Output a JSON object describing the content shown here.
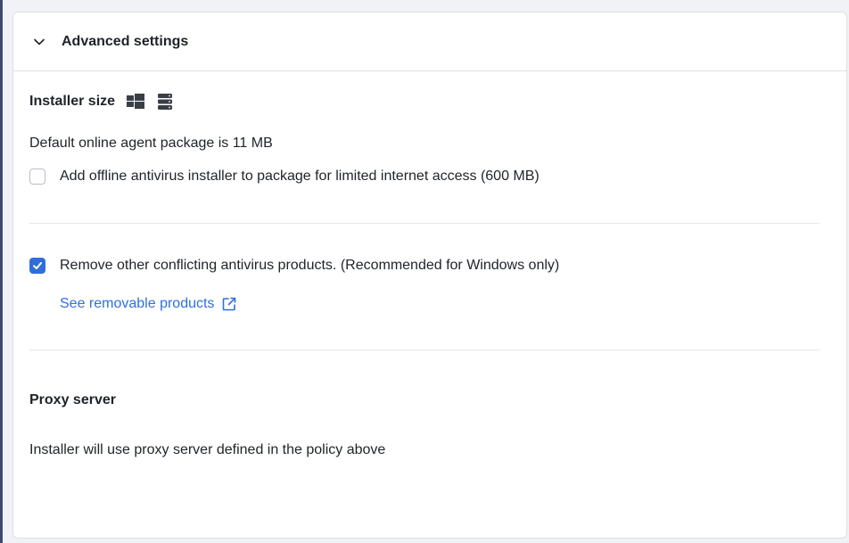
{
  "panel": {
    "header_title": "Advanced settings",
    "chevron_icon": "chevron-down-icon"
  },
  "installer": {
    "title": "Installer size",
    "icons": [
      "windows-icon",
      "server-icon"
    ],
    "default_text": "Default online agent package is 11 MB",
    "offline_checkbox": {
      "label": "Add offline antivirus installer to package for limited internet access (600 MB)",
      "checked": false
    }
  },
  "conflicts": {
    "remove_checkbox": {
      "label": "Remove other conflicting antivirus products. (Recommended for Windows only)",
      "checked": true
    },
    "link_label": "See removable products",
    "link_icon": "external-link-icon"
  },
  "proxy": {
    "title": "Proxy server",
    "text": "Installer will use proxy server defined in the policy above"
  },
  "colors": {
    "accent": "#2f6fdb",
    "border": "#dcdfe5",
    "text": "#1f2329"
  }
}
